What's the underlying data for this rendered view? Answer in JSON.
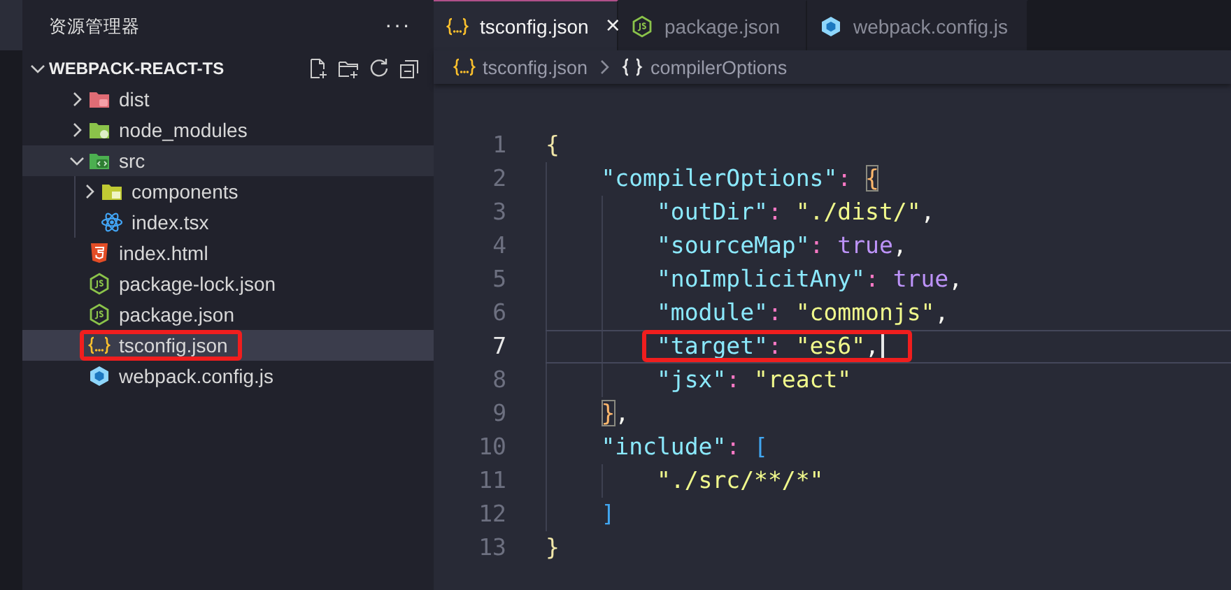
{
  "explorer": {
    "title": "资源管理器",
    "more": "···",
    "project": {
      "name": "WEBPACK-REACT-TS",
      "expanded": true
    },
    "items": [
      {
        "label": "dist",
        "kind": "folder-dist",
        "expanded": false,
        "selected": false,
        "hovered": false,
        "highlighted": false
      },
      {
        "label": "node_modules",
        "kind": "folder-node",
        "expanded": false,
        "selected": false,
        "hovered": false,
        "highlighted": false
      },
      {
        "label": "src",
        "kind": "folder-src",
        "expanded": true,
        "selected": false,
        "hovered": true,
        "highlighted": false,
        "children": [
          {
            "label": "components",
            "kind": "folder-components",
            "expanded": false,
            "selected": false,
            "hovered": false,
            "highlighted": false
          },
          {
            "label": "index.tsx",
            "kind": "react",
            "selected": false,
            "hovered": false,
            "highlighted": false
          }
        ]
      },
      {
        "label": "index.html",
        "kind": "html",
        "selected": false,
        "hovered": false,
        "highlighted": false
      },
      {
        "label": "package-lock.json",
        "kind": "node",
        "selected": false,
        "hovered": false,
        "highlighted": false
      },
      {
        "label": "package.json",
        "kind": "node",
        "selected": false,
        "hovered": false,
        "highlighted": false
      },
      {
        "label": "tsconfig.json",
        "kind": "json",
        "selected": true,
        "hovered": false,
        "highlighted": true
      },
      {
        "label": "webpack.config.js",
        "kind": "webpack",
        "selected": false,
        "hovered": false,
        "highlighted": false
      }
    ]
  },
  "tabs": [
    {
      "label": "tsconfig.json",
      "kind": "json",
      "selected": true,
      "close": "×"
    },
    {
      "label": "package.json",
      "kind": "node",
      "selected": false
    },
    {
      "label": "webpack.config.js",
      "kind": "webpack",
      "selected": false
    }
  ],
  "breadcrumb": [
    {
      "label": "tsconfig.json",
      "kind": "json"
    },
    {
      "label": "compilerOptions",
      "kind": "braces"
    }
  ],
  "code": [
    {
      "number": "1",
      "current": false,
      "annotated": false,
      "tokens": [
        {
          "kind": "bracket-1",
          "text": "{"
        }
      ]
    },
    {
      "number": "2",
      "current": false,
      "annotated": false,
      "tokens": [
        {
          "kind": "key",
          "text": "    \"compilerOptions\""
        },
        {
          "kind": "colon",
          "text": ": "
        },
        {
          "kind": "bracket-2-match",
          "text": "{"
        }
      ]
    },
    {
      "number": "3",
      "current": false,
      "annotated": false,
      "tokens": [
        {
          "kind": "key",
          "text": "        \"outDir\""
        },
        {
          "kind": "colon",
          "text": ": "
        },
        {
          "kind": "string",
          "text": "\"./dist/\""
        },
        {
          "kind": "punct",
          "text": ","
        }
      ]
    },
    {
      "number": "4",
      "current": false,
      "annotated": false,
      "tokens": [
        {
          "kind": "key",
          "text": "        \"sourceMap\""
        },
        {
          "kind": "colon",
          "text": ": "
        },
        {
          "kind": "bool",
          "text": "true"
        },
        {
          "kind": "punct",
          "text": ","
        }
      ]
    },
    {
      "number": "5",
      "current": false,
      "annotated": false,
      "tokens": [
        {
          "kind": "key",
          "text": "        \"noImplicitAny\""
        },
        {
          "kind": "colon",
          "text": ": "
        },
        {
          "kind": "bool",
          "text": "true"
        },
        {
          "kind": "punct",
          "text": ","
        }
      ]
    },
    {
      "number": "6",
      "current": false,
      "annotated": false,
      "tokens": [
        {
          "kind": "key",
          "text": "        \"module\""
        },
        {
          "kind": "colon",
          "text": ": "
        },
        {
          "kind": "string",
          "text": "\"commonjs\""
        },
        {
          "kind": "punct",
          "text": ","
        }
      ]
    },
    {
      "number": "7",
      "current": true,
      "annotated": true,
      "tokens": [
        {
          "kind": "key",
          "text": "        \"target\""
        },
        {
          "kind": "colon",
          "text": ": "
        },
        {
          "kind": "string",
          "text": "\"es6\""
        },
        {
          "kind": "punct",
          "text": ","
        }
      ]
    },
    {
      "number": "8",
      "current": false,
      "annotated": false,
      "tokens": [
        {
          "kind": "key",
          "text": "        \"jsx\""
        },
        {
          "kind": "colon",
          "text": ": "
        },
        {
          "kind": "string",
          "text": "\"react\""
        }
      ]
    },
    {
      "number": "9",
      "current": false,
      "annotated": false,
      "tokens": [
        {
          "kind": "bracket-2-match",
          "text": "    }"
        },
        {
          "kind": "punct",
          "text": ","
        }
      ]
    },
    {
      "number": "10",
      "current": false,
      "annotated": false,
      "tokens": [
        {
          "kind": "key",
          "text": "    \"include\""
        },
        {
          "kind": "colon",
          "text": ": "
        },
        {
          "kind": "bracket-3",
          "text": "["
        }
      ]
    },
    {
      "number": "11",
      "current": false,
      "annotated": false,
      "tokens": [
        {
          "kind": "string",
          "text": "        \"./src/**/*\""
        }
      ]
    },
    {
      "number": "12",
      "current": false,
      "annotated": false,
      "tokens": [
        {
          "kind": "bracket-3",
          "text": "    ]"
        }
      ]
    },
    {
      "number": "13",
      "current": false,
      "annotated": false,
      "tokens": [
        {
          "kind": "bracket-1",
          "text": "}"
        }
      ]
    }
  ]
}
